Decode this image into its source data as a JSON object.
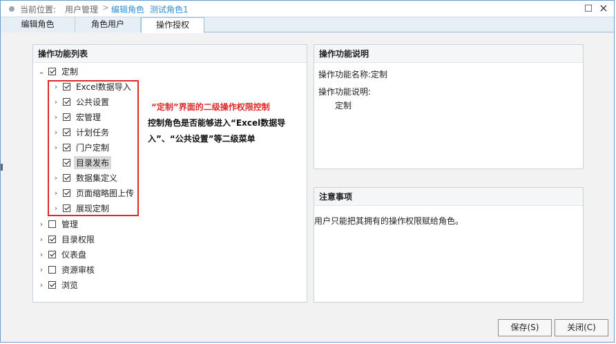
{
  "titlebar": {
    "location_label": "当前位置:",
    "crumbs": [
      "用户管理",
      "编辑角色",
      "测试角色1"
    ],
    "separator": ">",
    "maximize_icon": "□",
    "close_icon": "×"
  },
  "tabs": [
    {
      "label": "编辑角色"
    },
    {
      "label": "角色用户"
    },
    {
      "label": "操作授权"
    }
  ],
  "left_panel": {
    "title": "操作功能列表",
    "tree": [
      {
        "label": "定制",
        "checked": true,
        "expanded": true,
        "children": [
          {
            "label": "Excel数据导入",
            "checked": true
          },
          {
            "label": "公共设置",
            "checked": true
          },
          {
            "label": "宏管理",
            "checked": true
          },
          {
            "label": "计划任务",
            "checked": true
          },
          {
            "label": "门户定制",
            "checked": true
          },
          {
            "label": "目录发布",
            "checked": true,
            "selected": true
          },
          {
            "label": "数据集定义",
            "checked": true
          },
          {
            "label": "页面缩略图上传",
            "checked": true
          },
          {
            "label": "展现定制",
            "checked": true
          }
        ]
      },
      {
        "label": "管理",
        "checked": false
      },
      {
        "label": "目录权限",
        "checked": true
      },
      {
        "label": "仪表盘",
        "checked": true
      },
      {
        "label": "资源审核",
        "checked": false
      },
      {
        "label": "浏览",
        "checked": true
      }
    ]
  },
  "annotation": {
    "heading": "“定制”界面的二级操作权限控制",
    "line1": "控制角色是否能够进入“Excel数据导",
    "line2": "入”、“公共设置”等二级菜单"
  },
  "desc_panel": {
    "title": "操作功能说明",
    "name_line": "操作功能名称:定制",
    "desc_label": "操作功能说明:",
    "desc_value": "定制"
  },
  "notes_panel": {
    "title": "注意事项",
    "text": "用户只能把其拥有的操作权限赋给角色。"
  },
  "footer": {
    "save_label": "保存(S)",
    "close_label": "关闭(C)"
  }
}
